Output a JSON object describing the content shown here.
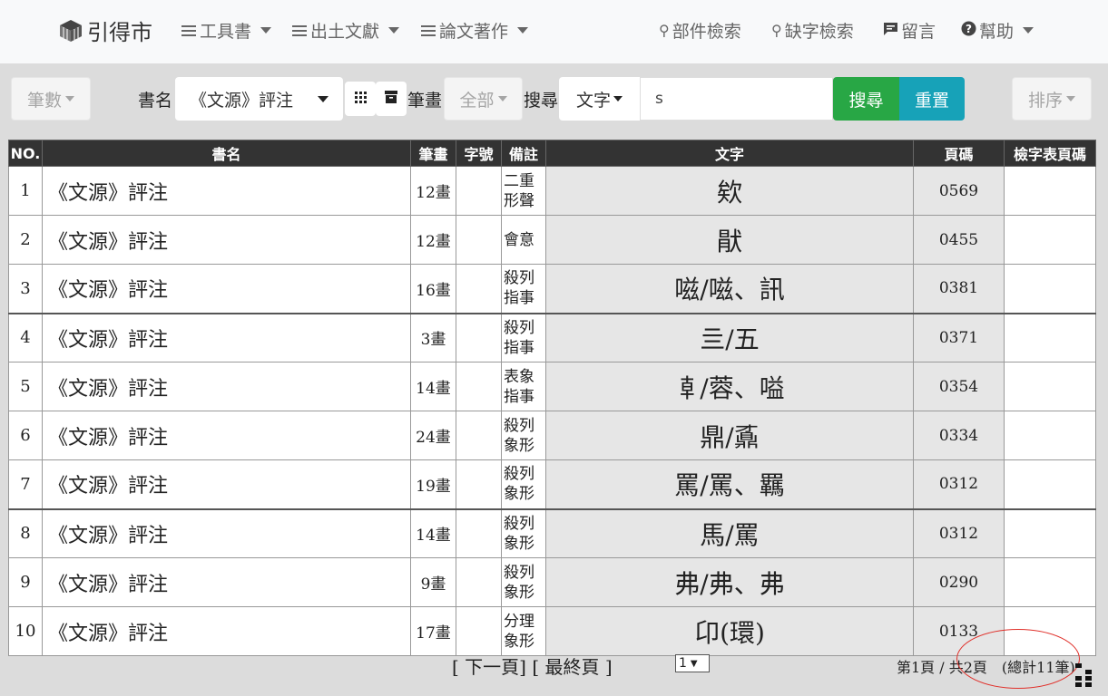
{
  "nav": {
    "brand": "引得市",
    "menus": [
      "工具書",
      "出土文獻",
      "論文著作"
    ],
    "right": [
      {
        "icon": "search-icon",
        "label": "部件檢索"
      },
      {
        "icon": "wrench-search-icon",
        "label": "缺字檢索"
      },
      {
        "icon": "comment-icon",
        "label": "留言"
      },
      {
        "icon": "question-icon",
        "label": "幫助"
      }
    ]
  },
  "toolbar": {
    "strokes_btn": "筆數",
    "book_label": "書名",
    "book_value": "《文源》評注",
    "stroke_label": "筆畫",
    "stroke_value": "全部",
    "search_label": "搜尋",
    "search_type": "文字",
    "search_value": "s",
    "search_btn": "搜尋",
    "reset_btn": "重置",
    "sort_btn": "排序"
  },
  "table": {
    "headers": [
      "NO.",
      "書名",
      "筆畫",
      "字號",
      "備註",
      "文字",
      "頁碼",
      "檢字表頁碼"
    ],
    "rows": [
      {
        "no": "1",
        "book": "《文源》評注",
        "strokes": "12畫",
        "code": "",
        "note1": "二重",
        "note2": "形聲",
        "char": "欸",
        "page": "0569",
        "idx": ""
      },
      {
        "no": "2",
        "book": "《文源》評注",
        "strokes": "12畫",
        "code": "",
        "note1": "會意",
        "note2": "",
        "char": "猒",
        "page": "0455",
        "idx": ""
      },
      {
        "no": "3",
        "book": "《文源》評注",
        "strokes": "16畫",
        "code": "",
        "note1": "殺列",
        "note2": "指事",
        "char": "嗞/嗞、訊",
        "page": "0381",
        "idx": ""
      },
      {
        "no": "4",
        "book": "《文源》評注",
        "strokes": "3畫",
        "code": "",
        "note1": "殺列",
        "note2": "指事",
        "char": "亖/五",
        "page": "0371",
        "idx": ""
      },
      {
        "no": "5",
        "book": "《文源》評注",
        "strokes": "14畫",
        "code": "",
        "note1": "表象",
        "note2": "指事",
        "char": "𠦝/蓉、嗌",
        "page": "0354",
        "idx": ""
      },
      {
        "no": "6",
        "book": "《文源》評注",
        "strokes": "24畫",
        "code": "",
        "note1": "殺列",
        "note2": "象形",
        "char": "鼎/鼒",
        "page": "0334",
        "idx": ""
      },
      {
        "no": "7",
        "book": "《文源》評注",
        "strokes": "19畫",
        "code": "",
        "note1": "殺列",
        "note2": "象形",
        "char": "罵/罵、羈",
        "page": "0312",
        "idx": ""
      },
      {
        "no": "8",
        "book": "《文源》評注",
        "strokes": "14畫",
        "code": "",
        "note1": "殺列",
        "note2": "象形",
        "char": "馬/罵",
        "page": "0312",
        "idx": ""
      },
      {
        "no": "9",
        "book": "《文源》評注",
        "strokes": "9畫",
        "code": "",
        "note1": "殺列",
        "note2": "象形",
        "char": "弗/弗、弗",
        "page": "0290",
        "idx": ""
      },
      {
        "no": "10",
        "book": "《文源》評注",
        "strokes": "17畫",
        "code": "",
        "note1": "分理",
        "note2": "象形",
        "char": "卬(環)",
        "page": "0133",
        "idx": ""
      }
    ]
  },
  "footer": {
    "next": "[ 下一頁]",
    "last": "[ 最終頁 ]",
    "page_select": "1",
    "summary": "第1頁 / 共2頁　(總計11筆)"
  }
}
